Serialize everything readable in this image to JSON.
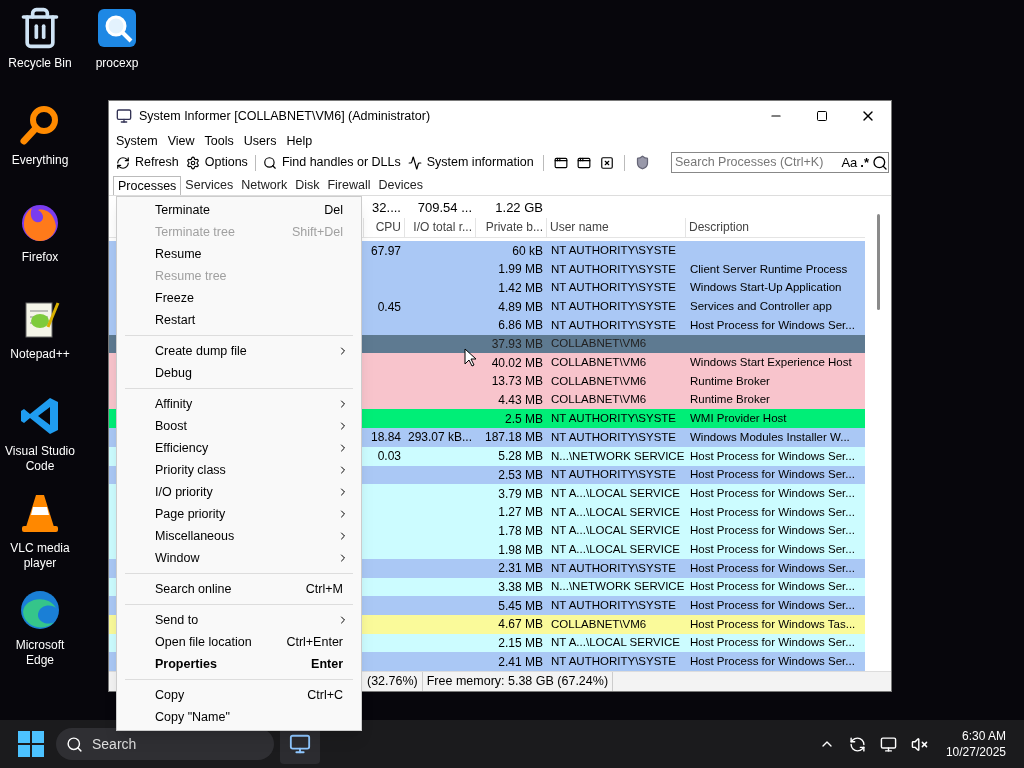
{
  "desktop_icons": [
    {
      "label": "Recycle Bin",
      "kind": "recycle"
    },
    {
      "label": "Everything",
      "kind": "everything"
    },
    {
      "label": "Firefox",
      "kind": "firefox"
    },
    {
      "label": "Notepad++",
      "kind": "notepad"
    },
    {
      "label": "Visual Studio Code",
      "kind": "vscode"
    },
    {
      "label": "VLC media player",
      "kind": "vlc"
    },
    {
      "label": "Microsoft Edge",
      "kind": "edge"
    },
    {
      "label": "procexp",
      "kind": "procexp"
    }
  ],
  "window": {
    "title": "System Informer [COLLABNET\\VM6] (Administrator)"
  },
  "menu_bar": [
    "System",
    "View",
    "Tools",
    "Users",
    "Help"
  ],
  "toolbar": {
    "buttons": [
      {
        "label": "Refresh",
        "kind": "refresh"
      },
      {
        "label": "Options",
        "kind": "options"
      },
      {
        "label": "Find handles or DLLs",
        "kind": "find"
      },
      {
        "label": "System information",
        "kind": "sysinfo"
      }
    ],
    "search": {
      "placeholder": "Search Processes (Ctrl+K)",
      "case_label": "Aa",
      "regex_label": ".*"
    }
  },
  "tabs": [
    {
      "label": "Processes",
      "selected": true
    },
    {
      "label": "Services",
      "selected": false
    },
    {
      "label": "Network",
      "selected": false
    },
    {
      "label": "Disk",
      "selected": false
    },
    {
      "label": "Firewall",
      "selected": false
    },
    {
      "label": "Devices",
      "selected": false
    }
  ],
  "table": {
    "summary": {
      "cpu": "32....",
      "io": "709.54 ...",
      "private": "1.22 GB"
    },
    "columns": [
      "CPU",
      "I/O total r...",
      "Private b...",
      "User name",
      "Description"
    ],
    "rows": [
      {
        "cpu": "67.97",
        "private": "60 kB",
        "user": "NT AUTHORITY\\SYSTE",
        "color": "#aac8f5",
        "selected": false
      },
      {
        "private": "1.99 MB",
        "user": "NT AUTHORITY\\SYSTE",
        "description": "Client Server Runtime Process",
        "color": "#aac8f5",
        "selected": false
      },
      {
        "private": "1.42 MB",
        "user": "NT AUTHORITY\\SYSTE",
        "description": "Windows Start-Up Application",
        "color": "#aac8f5",
        "selected": false
      },
      {
        "cpu": "0.45",
        "private": "4.89 MB",
        "user": "NT AUTHORITY\\SYSTE",
        "description": "Services and Controller app",
        "color": "#aac8f5",
        "selected": false
      },
      {
        "private": "6.86 MB",
        "user": "NT AUTHORITY\\SYSTE",
        "description": "Host Process for Windows Ser...",
        "color": "#aac8f5",
        "selected": false
      },
      {
        "private": "37.93 MB",
        "user": "COLLABNET\\VM6",
        "selected": true
      },
      {
        "private": "40.02 MB",
        "user": "COLLABNET\\VM6",
        "description": "Windows Start Experience Host",
        "color": "#f8c4cc",
        "selected": false
      },
      {
        "private": "13.73 MB",
        "user": "COLLABNET\\VM6",
        "description": "Runtime Broker",
        "color": "#f8c4cc",
        "selected": false
      },
      {
        "private": "4.43 MB",
        "user": "COLLABNET\\VM6",
        "description": "Runtime Broker",
        "color": "#f8c4cc",
        "selected": false
      },
      {
        "private": "2.5 MB",
        "user": "NT AUTHORITY\\SYSTE",
        "description": "WMI Provider Host",
        "color": "#00ee77",
        "selected": false
      },
      {
        "cpu": "18.84",
        "io": "293.07 kB...",
        "private": "187.18 MB",
        "user": "NT AUTHORITY\\SYSTE",
        "description": "Windows Modules Installer W...",
        "color": "#aac8f5",
        "selected": false
      },
      {
        "cpu": "0.03",
        "private": "5.28 MB",
        "user": "N...\\NETWORK SERVICE",
        "description": "Host Process for Windows Ser...",
        "color": "#ccfcff",
        "selected": false
      },
      {
        "private": "2.53 MB",
        "user": "NT AUTHORITY\\SYSTE",
        "description": "Host Process for Windows Ser...",
        "color": "#aac8f5",
        "selected": false
      },
      {
        "private": "3.79 MB",
        "user": "NT A...\\LOCAL SERVICE",
        "description": "Host Process for Windows Ser...",
        "color": "#ccfcff",
        "selected": false
      },
      {
        "private": "1.27 MB",
        "user": "NT A...\\LOCAL SERVICE",
        "description": "Host Process for Windows Ser...",
        "color": "#ccfcff",
        "selected": false
      },
      {
        "private": "1.78 MB",
        "user": "NT A...\\LOCAL SERVICE",
        "description": "Host Process for Windows Ser...",
        "color": "#ccfcff",
        "selected": false
      },
      {
        "private": "1.98 MB",
        "user": "NT A...\\LOCAL SERVICE",
        "description": "Host Process for Windows Ser...",
        "color": "#ccfcff",
        "selected": false
      },
      {
        "private": "2.31 MB",
        "user": "NT AUTHORITY\\SYSTE",
        "description": "Host Process for Windows Ser...",
        "color": "#aac8f5",
        "selected": false
      },
      {
        "private": "3.38 MB",
        "user": "N...\\NETWORK SERVICE",
        "description": "Host Process for Windows Ser...",
        "color": "#ccfcff",
        "selected": false
      },
      {
        "private": "5.45 MB",
        "user": "NT AUTHORITY\\SYSTE",
        "description": "Host Process for Windows Ser...",
        "color": "#aac8f5",
        "selected": false
      },
      {
        "private": "4.67 MB",
        "user": "COLLABNET\\VM6",
        "description": "Host Process for Windows Tas...",
        "color": "#fafa9a",
        "selected": false
      },
      {
        "private": "2.15 MB",
        "user": "NT A...\\LOCAL SERVICE",
        "description": "Host Process for Windows Ser...",
        "color": "#ccfcff",
        "selected": false
      },
      {
        "private": "2.41 MB",
        "user": "NT AUTHORITY\\SYSTE",
        "description": "Host Process for Windows Ser...",
        "color": "#aac8f5",
        "selected": false
      }
    ]
  },
  "status_bar": [
    "(32.76%)",
    "Free memory: 5.38 GB (67.24%)"
  ],
  "context_menu": [
    {
      "kind": "item",
      "label": "Terminate",
      "shortcut": "Del",
      "disabled": false,
      "submenu": false,
      "bold": false
    },
    {
      "kind": "item",
      "label": "Terminate tree",
      "shortcut": "Shift+Del",
      "disabled": true,
      "submenu": false,
      "bold": false
    },
    {
      "kind": "item",
      "label": "Resume",
      "disabled": false,
      "submenu": false,
      "bold": false
    },
    {
      "kind": "item",
      "label": "Resume tree",
      "disabled": true,
      "submenu": false,
      "bold": false
    },
    {
      "kind": "item",
      "label": "Freeze",
      "disabled": false,
      "submenu": false,
      "bold": false
    },
    {
      "kind": "item",
      "label": "Restart",
      "disabled": false,
      "submenu": false,
      "bold": false
    },
    {
      "kind": "separator"
    },
    {
      "kind": "item",
      "label": "Create dump file",
      "disabled": false,
      "submenu": true,
      "bold": false
    },
    {
      "kind": "item",
      "label": "Debug",
      "disabled": false,
      "submenu": false,
      "bold": false
    },
    {
      "kind": "separator"
    },
    {
      "kind": "item",
      "label": "Affinity",
      "disabled": false,
      "submenu": true,
      "bold": false
    },
    {
      "kind": "item",
      "label": "Boost",
      "disabled": false,
      "submenu": true,
      "bold": false
    },
    {
      "kind": "item",
      "label": "Efficiency",
      "disabled": false,
      "submenu": true,
      "bold": false
    },
    {
      "kind": "item",
      "label": "Priority class",
      "disabled": false,
      "submenu": true,
      "bold": false
    },
    {
      "kind": "item",
      "label": "I/O priority",
      "disabled": false,
      "submenu": true,
      "bold": false
    },
    {
      "kind": "item",
      "label": "Page priority",
      "disabled": false,
      "submenu": true,
      "bold": false
    },
    {
      "kind": "item",
      "label": "Miscellaneous",
      "disabled": false,
      "submenu": true,
      "bold": false
    },
    {
      "kind": "item",
      "label": "Window",
      "disabled": false,
      "submenu": true,
      "bold": false
    },
    {
      "kind": "separator"
    },
    {
      "kind": "item",
      "label": "Search online",
      "shortcut": "Ctrl+M",
      "disabled": false,
      "submenu": false,
      "bold": false
    },
    {
      "kind": "separator"
    },
    {
      "kind": "item",
      "label": "Send to",
      "disabled": false,
      "submenu": true,
      "bold": false
    },
    {
      "kind": "item",
      "label": "Open file location",
      "shortcut": "Ctrl+Enter",
      "disabled": false,
      "submenu": false,
      "bold": false
    },
    {
      "kind": "item",
      "label": "Properties",
      "shortcut": "Enter",
      "disabled": false,
      "submenu": false,
      "bold": true
    },
    {
      "kind": "separator"
    },
    {
      "kind": "item",
      "label": "Copy",
      "shortcut": "Ctrl+C",
      "disabled": false,
      "submenu": false,
      "bold": false
    },
    {
      "kind": "item",
      "label": "Copy \"Name\"",
      "disabled": false,
      "submenu": false,
      "bold": false
    }
  ],
  "taskbar": {
    "search_label": "Search",
    "time": "6:30 AM",
    "date": "10/27/2025"
  }
}
